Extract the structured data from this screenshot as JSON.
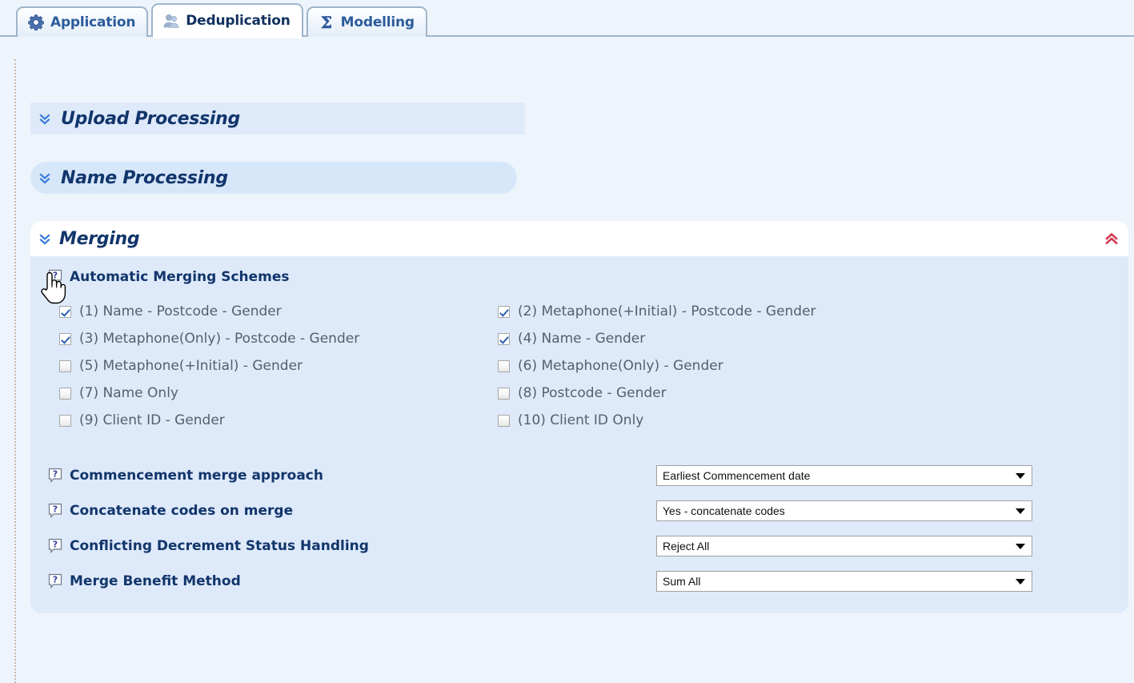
{
  "tabs": [
    {
      "label": "Application",
      "icon": "gear-icon",
      "active": false
    },
    {
      "label": "Deduplication",
      "icon": "users-icon",
      "active": true
    },
    {
      "label": "Modelling",
      "icon": "sigma-icon",
      "active": false
    }
  ],
  "sections": {
    "upload": {
      "title": "Upload Processing",
      "state": "collapsed",
      "toggle_icon": "chevron-double-down-icon"
    },
    "name": {
      "title": "Name Processing",
      "state": "collapsed",
      "toggle_icon": "chevron-double-down-icon"
    },
    "merging": {
      "title": "Merging",
      "state": "expanded",
      "toggle_icon": "chevron-double-up-icon",
      "group_heading": {
        "label": "Automatic Merging Schemes",
        "help_icon": "help-question-icon"
      },
      "schemes": [
        {
          "label": "(1) Name - Postcode - Gender",
          "checked": true
        },
        {
          "label": "(2) Metaphone(+Initial) - Postcode - Gender",
          "checked": true
        },
        {
          "label": "(3) Metaphone(Only) - Postcode - Gender",
          "checked": true
        },
        {
          "label": "(4) Name - Gender",
          "checked": true
        },
        {
          "label": "(5) Metaphone(+Initial) - Gender",
          "checked": false
        },
        {
          "label": "(6) Metaphone(Only) - Gender",
          "checked": false
        },
        {
          "label": "(7) Name Only",
          "checked": false
        },
        {
          "label": "(8) Postcode - Gender",
          "checked": false
        },
        {
          "label": "(9) Client ID - Gender",
          "checked": false
        },
        {
          "label": "(10) Client ID Only",
          "checked": false
        }
      ],
      "settings": [
        {
          "label": "Commencement merge approach",
          "value": "Earliest Commencement date",
          "help_icon": "help-question-icon",
          "arrow_icon": "chevron-down-icon"
        },
        {
          "label": "Concatenate codes on merge",
          "value": "Yes - concatenate codes",
          "help_icon": "help-question-icon",
          "arrow_icon": "chevron-down-icon"
        },
        {
          "label": "Conflicting Decrement Status Handling",
          "value": "Reject All",
          "help_icon": "help-question-icon",
          "arrow_icon": "chevron-down-icon"
        },
        {
          "label": "Merge Benefit Method",
          "value": "Sum All",
          "help_icon": "help-question-icon",
          "arrow_icon": "chevron-down-icon"
        }
      ]
    }
  },
  "cursor": {
    "icon": "pointing-hand-cursor"
  },
  "colors": {
    "page_background": "#eef4fc",
    "panel_background": "#deeafa",
    "heading_text": "#12356b",
    "tab_text": "#2b5c9b",
    "label_text": "#555f6e",
    "collapse_icon": "#d33b52",
    "expand_icon": "#3b7dd8",
    "checkbox_check": "#2a5fb0"
  }
}
